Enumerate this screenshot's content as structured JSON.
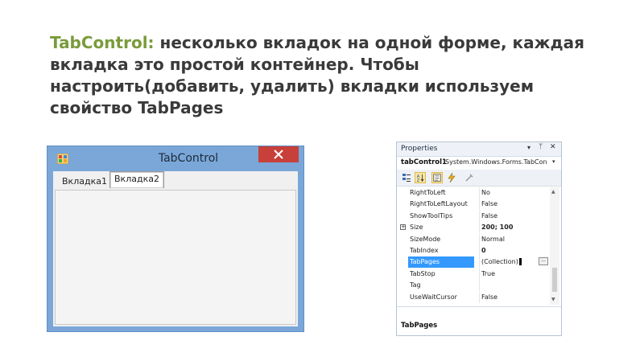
{
  "heading": {
    "highlight": "TabControl:",
    "text": " несколько вкладок на одной форме, каждая вкладка это простой контейнер. Чтобы настроить(добавить, удалить) вкладки используем свойство TabPages"
  },
  "form_window": {
    "title": "TabControl",
    "minimize_glyph": "–",
    "maximize_glyph": "□",
    "close_glyph": "✕",
    "tabs": [
      "Вкладка1",
      "Вкладка2"
    ],
    "selected_tab": "Вкладка2",
    "colors": {
      "frame": "#7aa7d8",
      "close": "#c7403a",
      "client": "#f0f0f0"
    }
  },
  "properties_panel": {
    "title": "Properties",
    "title_buttons": [
      "▾",
      "ᛘ",
      "✕"
    ],
    "object_name": "tabControl1",
    "object_type": "System.Windows.Forms.TabCon",
    "object_dropdown": "▾",
    "toolbar_icons": [
      "categorized-icon",
      "alphabetical-icon",
      "properties-icon",
      "events-icon",
      "property-pages-icon"
    ],
    "rows": [
      {
        "name": "RightToLeft",
        "value": "No"
      },
      {
        "name": "RightToLeftLayout",
        "value": "False"
      },
      {
        "name": "ShowToolTips",
        "value": "False"
      },
      {
        "name": "Size",
        "value": "200; 100",
        "expander": "+"
      },
      {
        "name": "SizeMode",
        "value": "Normal"
      },
      {
        "name": "TabIndex",
        "value": "0"
      },
      {
        "name": "TabPages",
        "value": "(Collection)",
        "button": "..."
      },
      {
        "name": "TabStop",
        "value": "True"
      },
      {
        "name": "Tag",
        "value": ""
      },
      {
        "name": "UseWaitCursor",
        "value": "False"
      }
    ],
    "selected_row": "TabPages",
    "description_title": "TabPages",
    "colors": {
      "selection": "#3399ff",
      "accent_heading": "#7a9b3b"
    }
  }
}
